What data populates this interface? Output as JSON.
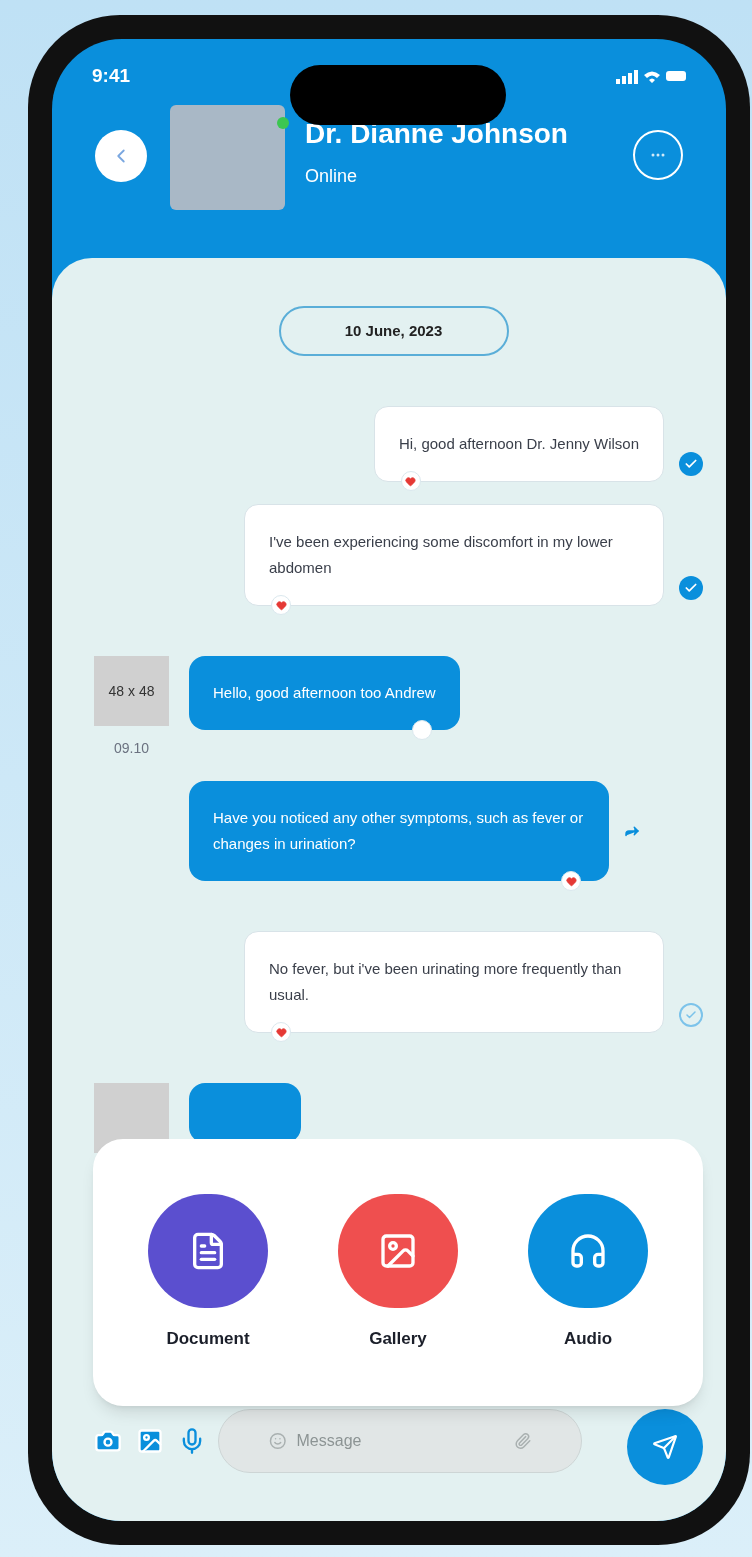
{
  "status_bar": {
    "time": "9:41"
  },
  "header": {
    "name": "Dr. Dianne Johnson",
    "status": "Online",
    "online": true
  },
  "chat": {
    "date": "10 June, 2023",
    "messages": [
      {
        "kind": "sent",
        "text": "Hi, good afternoon Dr. Jenny Wilson",
        "liked": true,
        "read": true
      },
      {
        "kind": "sent",
        "text": "I've been experiencing some discomfort in my lower abdomen",
        "liked": true,
        "read": true
      },
      {
        "kind": "received",
        "text": "Hello, good afternoon too Andrew",
        "avatar": "48 x 48",
        "time": "09.10",
        "liked": false
      },
      {
        "kind": "received",
        "text": "Have you noticed any other symptoms, such as fever or changes in urination?",
        "liked": true,
        "forwarded": true
      },
      {
        "kind": "sent",
        "text": "No fever, but i've been urinating more frequently than usual.",
        "liked": true,
        "read": false
      }
    ]
  },
  "attachments": [
    {
      "kind": "document",
      "label": "Document",
      "color": "#5b4fcf"
    },
    {
      "kind": "gallery",
      "label": "Gallery",
      "color": "#ef4f4f"
    },
    {
      "kind": "audio",
      "label": "Audio",
      "color": "#0a8fdc"
    }
  ],
  "composer": {
    "placeholder": "Message"
  }
}
